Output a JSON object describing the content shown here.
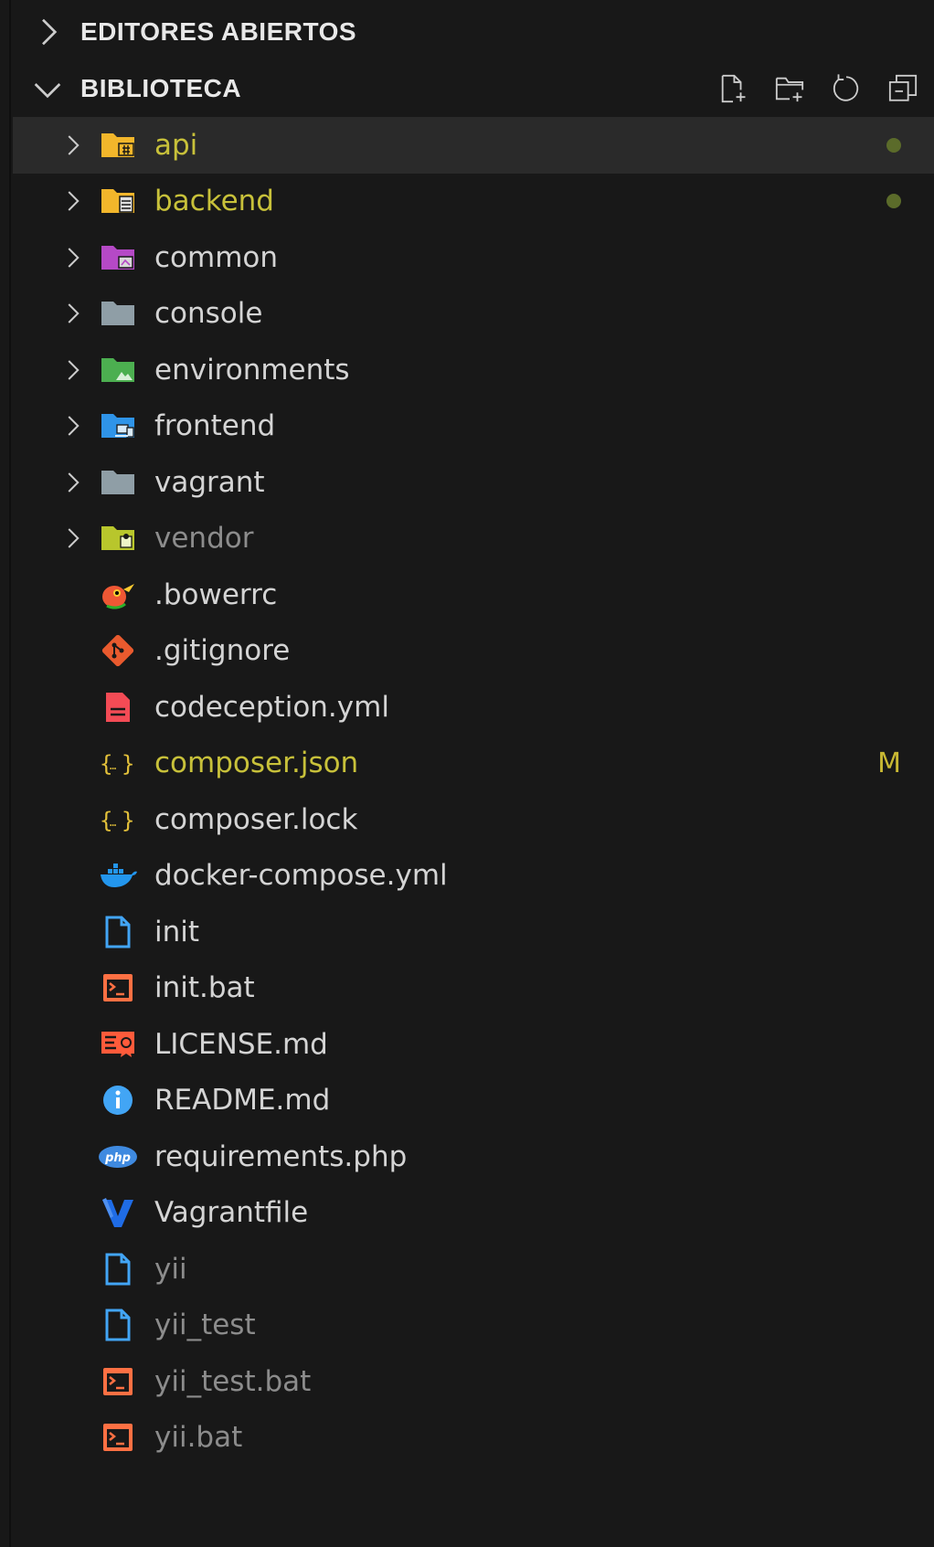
{
  "explorer": {
    "sections": [
      {
        "label": "EDITORES ABIERTOS",
        "expanded": false
      },
      {
        "label": "BIBLIOTECA",
        "expanded": true
      }
    ],
    "actions": [
      "new-file",
      "new-folder",
      "refresh",
      "collapse-all"
    ],
    "items": [
      {
        "label": "api",
        "kind": "folder",
        "status": "modified-dot"
      },
      {
        "label": "backend",
        "kind": "folder",
        "status": "modified-dot"
      },
      {
        "label": "common",
        "kind": "folder"
      },
      {
        "label": "console",
        "kind": "folder"
      },
      {
        "label": "environments",
        "kind": "folder"
      },
      {
        "label": "frontend",
        "kind": "folder"
      },
      {
        "label": "vagrant",
        "kind": "folder"
      },
      {
        "label": "vendor",
        "kind": "folder",
        "status": "ignored"
      },
      {
        "label": ".bowerrc",
        "kind": "file"
      },
      {
        "label": ".gitignore",
        "kind": "file"
      },
      {
        "label": "codeception.yml",
        "kind": "file"
      },
      {
        "label": "composer.json",
        "kind": "file",
        "status": "modified",
        "badge": "M"
      },
      {
        "label": "composer.lock",
        "kind": "file"
      },
      {
        "label": "docker-compose.yml",
        "kind": "file"
      },
      {
        "label": "init",
        "kind": "file"
      },
      {
        "label": "init.bat",
        "kind": "file"
      },
      {
        "label": "LICENSE.md",
        "kind": "file"
      },
      {
        "label": "README.md",
        "kind": "file"
      },
      {
        "label": "requirements.php",
        "kind": "file"
      },
      {
        "label": "Vagrantfile",
        "kind": "file"
      },
      {
        "label": "yii",
        "kind": "file",
        "status": "ignored"
      },
      {
        "label": "yii_test",
        "kind": "file",
        "status": "ignored"
      },
      {
        "label": "yii_test.bat",
        "kind": "file",
        "status": "ignored"
      },
      {
        "label": "yii.bat",
        "kind": "file",
        "status": "ignored"
      }
    ]
  },
  "colors": {
    "background": "#181818",
    "selected_row": "#2a2a2a",
    "modified_text": "#c8c13a",
    "ignored_text": "#8c8c8c",
    "dot": "#5b6b2a"
  }
}
